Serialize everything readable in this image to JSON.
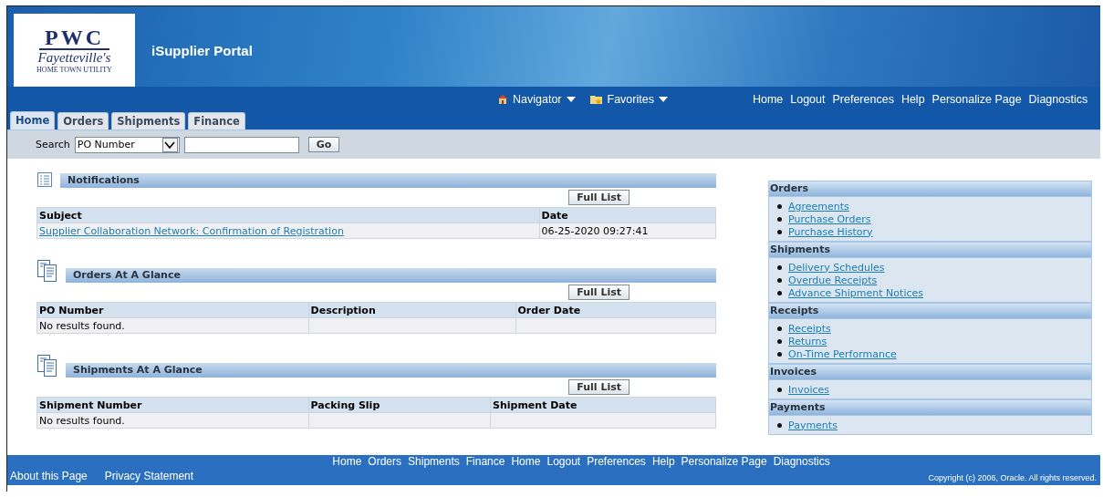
{
  "logo": {
    "mark": "PWC",
    "name": "Fayetteville's",
    "tagline": "HOME TOWN UTILITY"
  },
  "app_title": "iSupplier Portal",
  "global_menus": [
    {
      "kind": "navigator",
      "label": "Navigator"
    },
    {
      "kind": "favorites",
      "label": "Favorites"
    }
  ],
  "global_links": [
    "Home",
    "Logout",
    "Preferences",
    "Help",
    "Personalize Page",
    "Diagnostics"
  ],
  "tabs": [
    {
      "label": "Home",
      "selected": true
    },
    {
      "label": "Orders",
      "selected": false
    },
    {
      "label": "Shipments",
      "selected": false
    },
    {
      "label": "Finance",
      "selected": false
    }
  ],
  "search": {
    "label": "Search",
    "field_select": "PO Number",
    "button": "Go"
  },
  "sections": [
    {
      "title": "Notifications",
      "kind": "list",
      "button": "Full List",
      "columns": [
        "Subject",
        "Date"
      ],
      "rows": [
        [
          {
            "text": "Supplier Collaboration Network: Confirmation of Registration",
            "kind": "link"
          },
          {
            "text": "06-25-2020 09:27:41",
            "kind": "text"
          }
        ]
      ]
    },
    {
      "title": "Orders At A Glance",
      "kind": "docs",
      "button": "Full List",
      "columns": [
        "PO Number",
        "Description",
        "Order Date"
      ],
      "rows": [
        [
          {
            "text": "No results found.",
            "kind": "text"
          }
        ]
      ]
    },
    {
      "title": "Shipments At A Glance",
      "kind": "docs",
      "button": "Full List",
      "columns": [
        "Shipment Number",
        "Packing Slip",
        "Shipment Date"
      ],
      "rows": [
        [
          {
            "text": "No results found.",
            "kind": "text"
          }
        ]
      ]
    }
  ],
  "side_groups": [
    {
      "title": "Orders",
      "links": [
        "Agreements",
        "Purchase Orders",
        "Purchase History"
      ]
    },
    {
      "title": "Shipments",
      "links": [
        "Delivery Schedules",
        "Overdue Receipts",
        "Advance Shipment Notices"
      ]
    },
    {
      "title": "Receipts",
      "links": [
        "Receipts",
        "Returns",
        "On-Time Performance"
      ]
    },
    {
      "title": "Invoices",
      "links": [
        "Invoices"
      ]
    },
    {
      "title": "Payments",
      "links": [
        "Payments"
      ]
    }
  ],
  "footer": {
    "links": [
      "Home",
      "Orders",
      "Shipments",
      "Finance",
      "Home",
      "Logout",
      "Preferences",
      "Help",
      "Personalize Page",
      "Diagnostics"
    ],
    "left_links": [
      "About this Page",
      "Privacy Statement"
    ],
    "copyright": "Copyright (c) 2006, Oracle. All rights reserved."
  }
}
